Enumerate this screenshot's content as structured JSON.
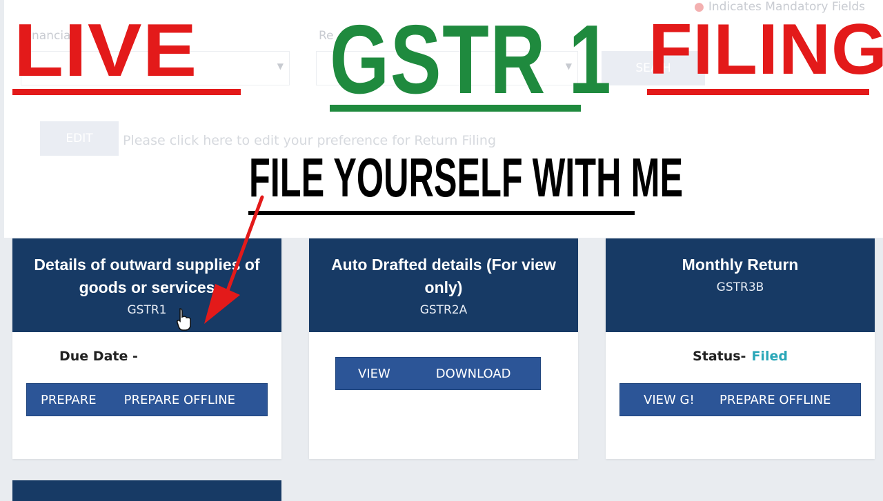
{
  "form": {
    "mandatory_note": "Indicates Mandatory Fields",
    "financial_year_label": "nancial",
    "return_period_label": "Re",
    "search_button": "SEA    H",
    "edit_button": "EDIT",
    "edit_hint": "Please click here to edit your preference for Return Filing"
  },
  "overlay": {
    "live": "LIVE",
    "gstr": "GSTR 1",
    "filing": "FILING",
    "tagline": "FILE YOURSELF WITH ME"
  },
  "cards": [
    {
      "title": "Details of outward supplies of goods or services",
      "code": "GSTR1",
      "due_label": "Due Date -",
      "buttons": [
        "PREPARE",
        "PREPARE OFFLINE"
      ]
    },
    {
      "title": "Auto Drafted details (For view only)",
      "code": "GSTR2A",
      "buttons": [
        "VIEW",
        "DOWNLOAD"
      ]
    },
    {
      "title": "Monthly Return",
      "code": "GSTR3B",
      "status_label": "Status-",
      "status_value": "Filed",
      "buttons": [
        "VIEW G!",
        "PREPARE OFFLINE"
      ]
    }
  ],
  "colors": {
    "card_header": "#173a65",
    "button": "#2c5597",
    "red": "#e31a1a",
    "green": "#1f8a3e",
    "filed": "#2aa7b8"
  }
}
